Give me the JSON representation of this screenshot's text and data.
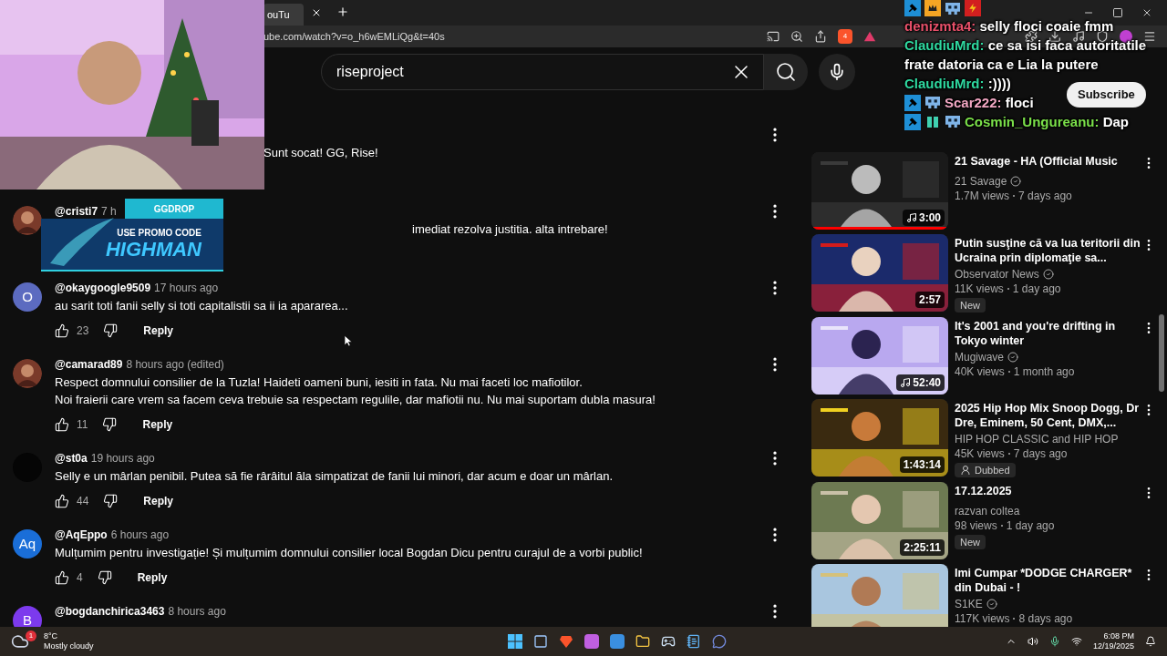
{
  "browser": {
    "tab": {
      "title": "ouTu"
    },
    "address": "ube.com/watch?v=o_h6wEMLiQg&t=40s",
    "shield_count": "4"
  },
  "search": {
    "value": "riseproject"
  },
  "subscribe": "Subscribe",
  "comments": [
    {
      "kind": "under_camera",
      "text": "Sunt socat! GG, Rise!"
    },
    {
      "kind": "under_banner",
      "author": "@cristi7",
      "time": "7 h",
      "text": "imediat rezolva justitia. alta intrebare!"
    },
    {
      "kind": "normal",
      "avatar": {
        "kind": "letter",
        "letter": "O",
        "color": "#5c6bc0"
      },
      "author": "@okaygoogle9509",
      "time": "17 hours ago",
      "text": "au sarit toti fanii selly si toti capitalistii sa ii ia apararea...",
      "likes": "23",
      "reply": "Reply"
    },
    {
      "kind": "normal",
      "author": "@camarad89",
      "time": "8 hours ago (edited)",
      "text": "Respect domnului consilier de la Tuzla! Haideti oameni buni, iesiti in fata. Nu mai faceti loc mafiotilor.\nNoi fraierii care vrem sa facem ceva trebuie sa respectam regulile, dar mafiotii nu. Nu mai suportam dubla masura!",
      "likes": "11",
      "reply": "Reply"
    },
    {
      "kind": "normal",
      "avatar": {
        "kind": "dark"
      },
      "author": "@st0a",
      "time": "19 hours ago",
      "text": "Selly e un mârlan penibil. Putea să fie rârâitul ăla simpatizat de fanii lui minori, dar acum e doar un mârlan.",
      "likes": "44",
      "reply": "Reply"
    },
    {
      "kind": "normal",
      "avatar": {
        "kind": "letter",
        "letter": "Aq",
        "color": "#1a6ed8"
      },
      "author": "@AqEppo",
      "time": "6 hours ago",
      "text": "Mulțumim pentru investigație! Și mulțumim domnului consilier local Bogdan Dicu pentru curajul de a vorbi public!",
      "likes": "4",
      "reply": "Reply"
    },
    {
      "kind": "normal",
      "avatar": {
        "kind": "letter",
        "letter": "B",
        "color": "#7c3aed"
      },
      "author": "@bogdanchirica3463",
      "time": "8 hours ago"
    }
  ],
  "videos": [
    {
      "title": "21 Savage - HA (Official Music",
      "channel": "21 Savage",
      "verified": true,
      "views": "1.7M views",
      "age": "7 days ago",
      "duration": "3:00",
      "music": true,
      "level": 1
    },
    {
      "title": "Putin susţine că va lua teritorii din Ucraina prin diplomaţie sa...",
      "channel": "Observator News",
      "verified": true,
      "views": "11K views",
      "age": "1 day ago",
      "duration": "2:57",
      "music": false,
      "badge": {
        "kind": "new",
        "label": "New"
      }
    },
    {
      "title": "It's 2001 and you're drifting in Tokyo winter",
      "channel": "Mugiwave",
      "verified": true,
      "views": "40K views",
      "age": "1 month ago",
      "duration": "52:40",
      "music": true
    },
    {
      "title": "2025 Hip Hop Mix Snoop Dogg, Dr Dre, Eminem, 50 Cent, DMX,...",
      "channel": "HIP HOP CLASSIC and HIP HOP",
      "verified": false,
      "views": "45K views",
      "age": "7 days ago",
      "duration": "1:43:14",
      "music": false,
      "badge": {
        "kind": "dubbed",
        "label": "Dubbed"
      }
    },
    {
      "title": "17.12.2025",
      "channel": "razvan coltea",
      "verified": false,
      "views": "98 views",
      "age": "1 day ago",
      "duration": "2:25:11",
      "music": false,
      "badge": {
        "kind": "new",
        "label": "New"
      }
    },
    {
      "title": "Imi Cumpar *DODGE CHARGER* din Dubai - !",
      "channel": "S1KE",
      "verified": true,
      "views": "117K views",
      "age": "8 days ago"
    }
  ],
  "chat": [
    {
      "badges": [
        {
          "kind": "hammer"
        },
        {
          "kind": "crown"
        },
        {
          "kind": "alien"
        },
        {
          "kind": "bolt"
        }
      ],
      "name": "denizmta4:",
      "color": "#e8506a",
      "text": "selly floci coaie fmm"
    },
    {
      "name": "ClaudiuMrd:",
      "color": "#2fd9a0",
      "text": "ce sa isi faca autoritatile frate datoria ca e Lia la putere"
    },
    {
      "name": "ClaudiuMrd:",
      "color": "#2fd9a0",
      "text": ":))))"
    },
    {
      "badges": [
        {
          "kind": "hammer"
        },
        {
          "kind": "alien"
        }
      ],
      "name": "Scar222:",
      "color": "#f2a7c3",
      "text": "floci"
    },
    {
      "badges": [
        {
          "kind": "hammer"
        },
        {
          "kind": "bits"
        },
        {
          "kind": "alien"
        }
      ],
      "name": "Cosmin_Ungureanu:",
      "color": "#7be04a",
      "text": "Dap"
    }
  ],
  "promo": {
    "brand": "GGDROP",
    "line1": "USE PROMO CODE",
    "code": "HIGHMAN"
  },
  "taskbar": {
    "temperature": "8°C",
    "weather": "Mostly cloudy",
    "weather_alert": "1",
    "time": "6:08 PM",
    "date": "12/19/2025"
  }
}
